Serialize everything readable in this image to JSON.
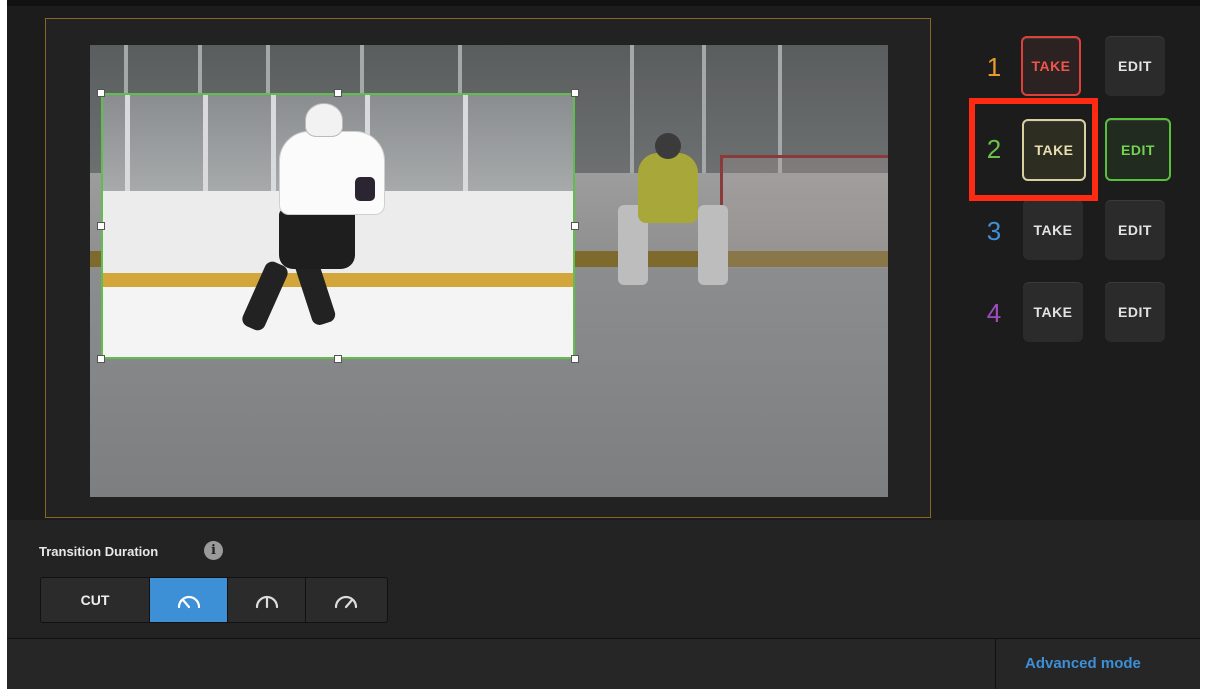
{
  "switcher": {
    "inputs": [
      {
        "number": "1",
        "number_color": "#e89b2c",
        "take_label": "TAKE",
        "edit_label": "EDIT",
        "state": "program"
      },
      {
        "number": "2",
        "number_color": "#6cc04a",
        "take_label": "TAKE",
        "edit_label": "EDIT",
        "state": "editing"
      },
      {
        "number": "3",
        "number_color": "#3d8fd6",
        "take_label": "TAKE",
        "edit_label": "EDIT",
        "state": "idle"
      },
      {
        "number": "4",
        "number_color": "#a04ac0",
        "take_label": "TAKE",
        "edit_label": "EDIT",
        "state": "idle"
      }
    ]
  },
  "transition": {
    "label": "Transition Duration",
    "info_icon": "info-icon",
    "options": [
      {
        "label": "CUT",
        "icon": "",
        "active": false
      },
      {
        "label": "",
        "icon": "speed-fast-icon",
        "active": true
      },
      {
        "label": "",
        "icon": "speed-medium-icon",
        "active": false
      },
      {
        "label": "",
        "icon": "speed-slow-icon",
        "active": false
      }
    ]
  },
  "footer": {
    "mode_link": "Advanced mode"
  },
  "colors": {
    "accent_blue": "#3d8fd6",
    "program_red": "#e0403a",
    "crop_green": "#5fbf4a",
    "highlight_red": "#ff2a12"
  }
}
